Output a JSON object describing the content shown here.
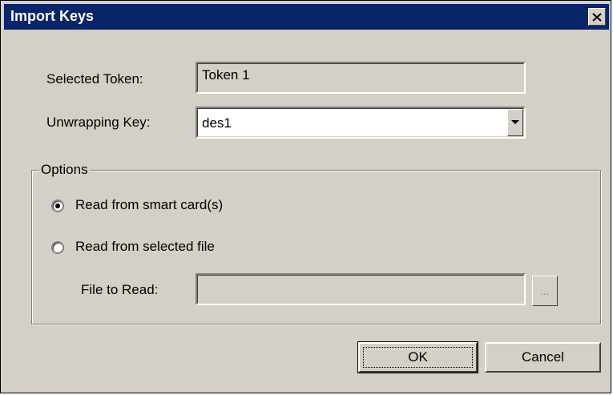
{
  "window": {
    "title": "Import Keys",
    "close_icon": "close-icon"
  },
  "form": {
    "selected_token_label": "Selected Token:",
    "selected_token_value": "Token 1",
    "unwrapping_key_label": "Unwrapping Key:",
    "unwrapping_key_value": "des1"
  },
  "options": {
    "legend": "Options",
    "radio_smart_card_label": "Read from smart card(s)",
    "radio_smart_card_selected": true,
    "radio_file_label": "Read from selected file",
    "radio_file_selected": false,
    "file_to_read_label": "File to Read:",
    "file_to_read_value": "",
    "browse_label": "..."
  },
  "buttons": {
    "ok_label": "OK",
    "cancel_label": "Cancel"
  },
  "colors": {
    "titlebar": "#0a246a",
    "face": "#d4d0c8"
  }
}
